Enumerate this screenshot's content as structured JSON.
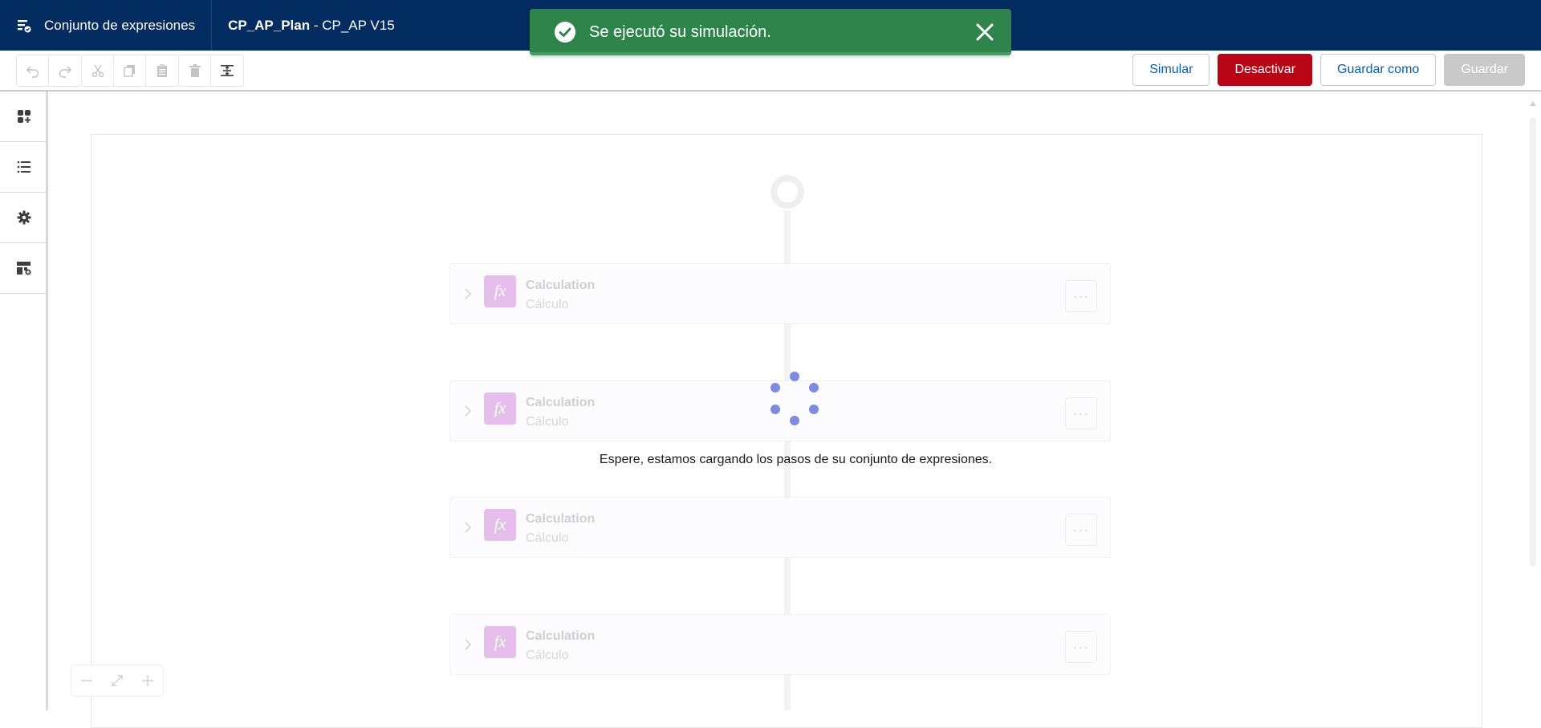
{
  "header": {
    "app_name": "Conjunto de expresiones",
    "doc_name": "CP_AP_Plan",
    "doc_separator": " - ",
    "doc_version": "CP_AP V15",
    "icons": {
      "app": "expression-set-icon"
    },
    "colors": {
      "background": "#032d60"
    }
  },
  "toast": {
    "message": "Se ejecutó su simulación.",
    "icons": {
      "status": "success-check-icon",
      "close": "close-icon"
    },
    "colors": {
      "background": "#2e844a"
    }
  },
  "toolbar": {
    "tools": [
      {
        "name": "undo-icon",
        "enabled": false
      },
      {
        "name": "redo-icon",
        "enabled": false
      },
      {
        "name": "cut-icon",
        "enabled": false
      },
      {
        "name": "copy-icon",
        "enabled": false
      },
      {
        "name": "paste-icon",
        "enabled": false
      },
      {
        "name": "delete-icon",
        "enabled": false
      },
      {
        "name": "expand-collapse-icon",
        "enabled": true
      }
    ],
    "simulate_label": "Simular",
    "deactivate_label": "Desactivar",
    "save_as_label": "Guardar como",
    "save_label": "Guardar",
    "colors": {
      "danger": "#ba0517",
      "link": "#0b5cab",
      "disabled": "#c9c9c9"
    }
  },
  "rail": {
    "items": [
      {
        "name": "elements-grid-icon"
      },
      {
        "name": "list-icon"
      },
      {
        "name": "settings-gear-icon"
      },
      {
        "name": "resources-layout-icon"
      }
    ]
  },
  "canvas": {
    "steps": [
      {
        "title": "Calculation",
        "subtitle": "Cálculo",
        "icon_text": "fx"
      },
      {
        "title": "Calculation",
        "subtitle": "Cálculo",
        "icon_text": "fx"
      },
      {
        "title": "Calculation",
        "subtitle": "Cálculo",
        "icon_text": "fx"
      },
      {
        "title": "Calculation",
        "subtitle": "Cálculo",
        "icon_text": "fx"
      }
    ],
    "loading_text": "Espere, estamos cargando los pasos de su conjunto de expresiones.",
    "more_label": "···",
    "zoom": {
      "zoom_out": "minus-icon",
      "fit": "fit-to-screen-icon",
      "zoom_in": "plus-icon"
    }
  }
}
